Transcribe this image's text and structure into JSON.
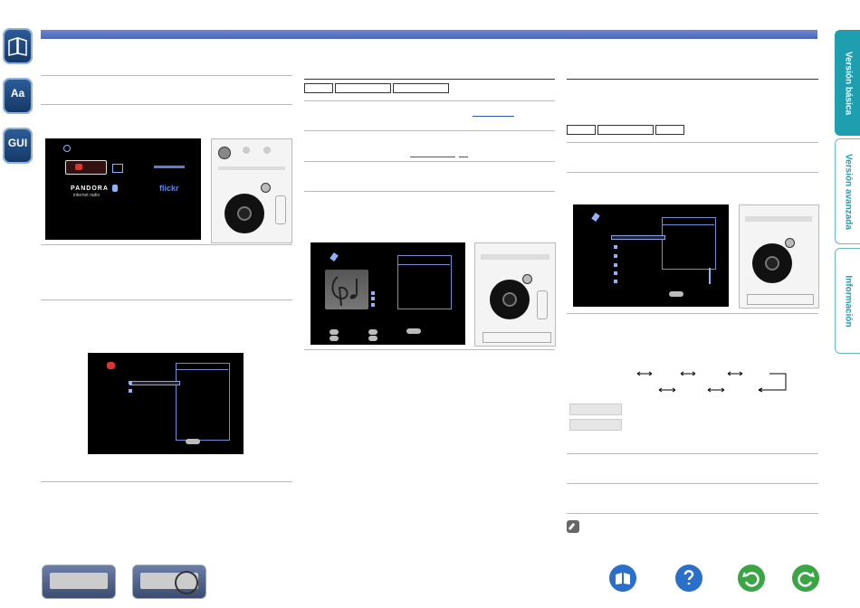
{
  "left_icons": [
    {
      "name": "manual-icon",
      "label": ""
    },
    {
      "name": "aa-icon",
      "label": "Aa"
    },
    {
      "name": "gui-icon",
      "label": "GUI"
    }
  ],
  "right_tabs": [
    {
      "name": "tab-version-basica",
      "label": "Versión básica",
      "active": true
    },
    {
      "name": "tab-version-avanzada",
      "label": "Versión avanzada",
      "active": false
    },
    {
      "name": "tab-informacion",
      "label": "Información",
      "active": false
    }
  ],
  "col1": {
    "screen1": {
      "logos": [
        "PANDORA",
        "internet radio",
        "flickr"
      ]
    }
  },
  "bottom_nav": {
    "icons": [
      "book-icon",
      "help-icon",
      "back-icon",
      "forward-icon"
    ]
  },
  "colors": {
    "accent": "#1f9eb0",
    "bar": "#4a67bd",
    "nav_blue": "#2a6fc9",
    "nav_green": "#3aa545"
  }
}
